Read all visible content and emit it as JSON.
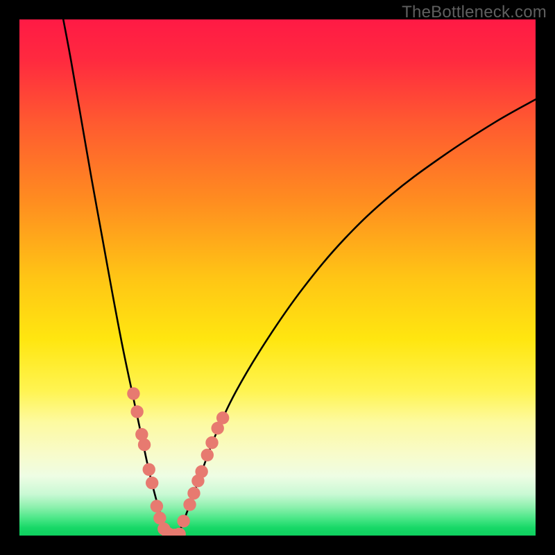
{
  "watermark": "TheBottleneck.com",
  "colors": {
    "frame": "#000000",
    "dot": "#e77a70",
    "curve": "#000000",
    "gradient_stops": [
      {
        "h": 0.0,
        "c": "#ff1a45"
      },
      {
        "h": 0.08,
        "c": "#ff2a3f"
      },
      {
        "h": 0.2,
        "c": "#ff5a30"
      },
      {
        "h": 0.35,
        "c": "#ff8c20"
      },
      {
        "h": 0.5,
        "c": "#ffc515"
      },
      {
        "h": 0.62,
        "c": "#ffe610"
      },
      {
        "h": 0.72,
        "c": "#fff452"
      },
      {
        "h": 0.78,
        "c": "#fdfaa0"
      },
      {
        "h": 0.84,
        "c": "#f8fbc9"
      },
      {
        "h": 0.885,
        "c": "#eefde4"
      },
      {
        "h": 0.92,
        "c": "#c9f9d4"
      },
      {
        "h": 0.945,
        "c": "#8cf0ad"
      },
      {
        "h": 0.965,
        "c": "#4fe88a"
      },
      {
        "h": 0.985,
        "c": "#17d867"
      },
      {
        "h": 1.0,
        "c": "#0ecf5e"
      }
    ]
  },
  "chart_data": {
    "type": "line",
    "title": "",
    "xlabel": "",
    "ylabel": "",
    "x_range": [
      0,
      100
    ],
    "y_range": [
      0,
      100
    ],
    "series": [
      {
        "name": "bottleneck-curve",
        "type": "smooth-line",
        "x": [
          8.5,
          10,
          12,
          14,
          16,
          18,
          20,
          22,
          23.5,
          25,
          26.5,
          28,
          29,
          30,
          30.8,
          31.5,
          33,
          35,
          38,
          42,
          48,
          55,
          63,
          72,
          82,
          92,
          100
        ],
        "y": [
          100,
          92,
          80.5,
          69,
          58,
          47,
          36.5,
          27,
          20,
          13,
          7,
          2,
          0.5,
          0,
          0.5,
          2,
          6,
          11.5,
          19.5,
          28,
          38,
          48,
          57.5,
          66,
          73.5,
          80,
          84.5
        ]
      },
      {
        "name": "left-branch-dots",
        "type": "scatter",
        "x": [
          22.1,
          22.8,
          23.7,
          24.2,
          25.1,
          25.7,
          26.6,
          27.2,
          28.0,
          28.8,
          29.5,
          30.2,
          31.0
        ],
        "y": [
          27.5,
          24.0,
          19.6,
          17.6,
          12.8,
          10.2,
          5.7,
          3.4,
          1.3,
          0.4,
          0.1,
          0.1,
          0.3
        ]
      },
      {
        "name": "right-branch-dots",
        "type": "scatter",
        "x": [
          31.8,
          33.0,
          33.8,
          34.6,
          35.3,
          36.4,
          37.3,
          38.4,
          39.4
        ],
        "y": [
          2.8,
          6.0,
          8.2,
          10.6,
          12.4,
          15.6,
          18.0,
          20.8,
          22.8
        ]
      }
    ]
  }
}
